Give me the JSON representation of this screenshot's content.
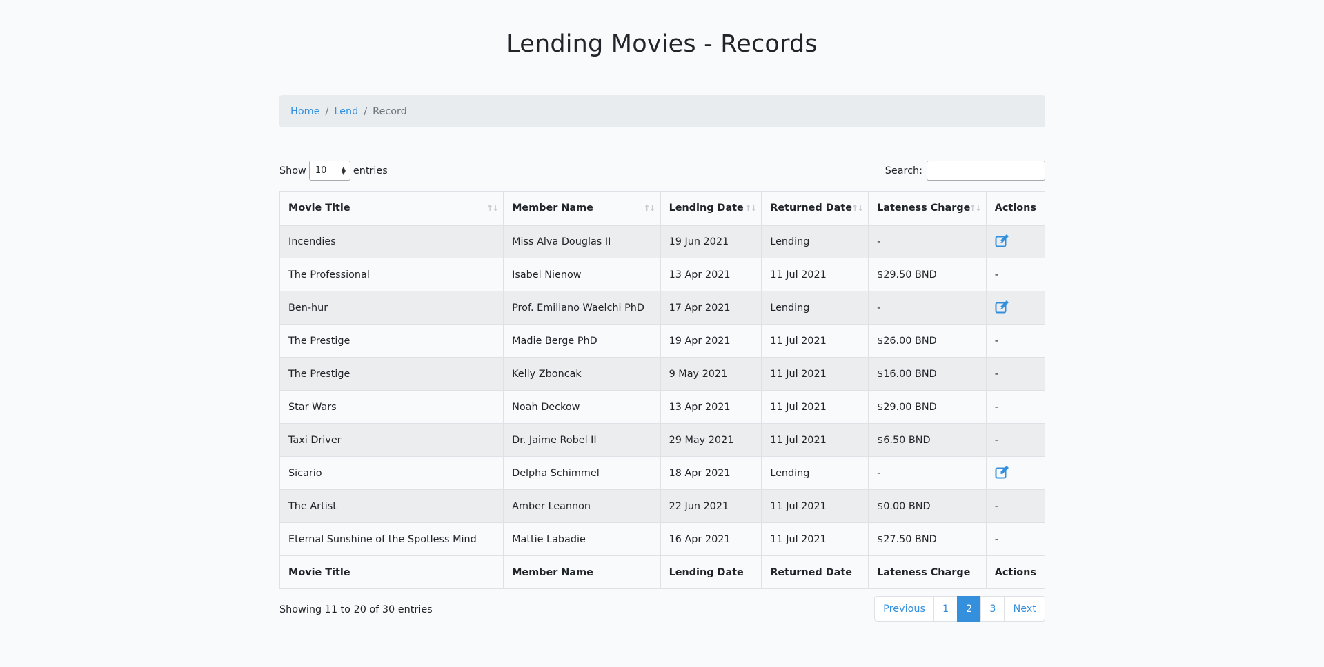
{
  "page": {
    "title": "Lending Movies - Records"
  },
  "breadcrumb": {
    "home": "Home",
    "lend": "Lend",
    "record": "Record",
    "separator": "/"
  },
  "controls": {
    "show_label": "Show",
    "entries_value": "10",
    "entries_label": "entries",
    "search_label": "Search:",
    "search_value": ""
  },
  "table": {
    "columns": [
      "Movie Title",
      "Member Name",
      "Lending Date",
      "Returned Date",
      "Lateness Charge",
      "Actions"
    ],
    "rows": [
      {
        "title": "Incendies",
        "member": "Miss Alva Douglas II",
        "lend": "19 Jun 2021",
        "returned": "Lending",
        "charge": "-",
        "action": "edit"
      },
      {
        "title": "The Professional",
        "member": "Isabel Nienow",
        "lend": "13 Apr 2021",
        "returned": "11 Jul 2021",
        "charge": "$29.50 BND",
        "action": "-"
      },
      {
        "title": "Ben-hur",
        "member": "Prof. Emiliano Waelchi PhD",
        "lend": "17 Apr 2021",
        "returned": "Lending",
        "charge": "-",
        "action": "edit"
      },
      {
        "title": "The Prestige",
        "member": "Madie Berge PhD",
        "lend": "19 Apr 2021",
        "returned": "11 Jul 2021",
        "charge": "$26.00 BND",
        "action": "-"
      },
      {
        "title": "The Prestige",
        "member": "Kelly Zboncak",
        "lend": "9 May 2021",
        "returned": "11 Jul 2021",
        "charge": "$16.00 BND",
        "action": "-"
      },
      {
        "title": "Star Wars",
        "member": "Noah Deckow",
        "lend": "13 Apr 2021",
        "returned": "11 Jul 2021",
        "charge": "$29.00 BND",
        "action": "-"
      },
      {
        "title": "Taxi Driver",
        "member": "Dr. Jaime Robel II",
        "lend": "29 May 2021",
        "returned": "11 Jul 2021",
        "charge": "$6.50 BND",
        "action": "-"
      },
      {
        "title": "Sicario",
        "member": "Delpha Schimmel",
        "lend": "18 Apr 2021",
        "returned": "Lending",
        "charge": "-",
        "action": "edit"
      },
      {
        "title": "The Artist",
        "member": "Amber Leannon",
        "lend": "22 Jun 2021",
        "returned": "11 Jul 2021",
        "charge": "$0.00 BND",
        "action": "-"
      },
      {
        "title": "Eternal Sunshine of the Spotless Mind",
        "member": "Mattie Labadie",
        "lend": "16 Apr 2021",
        "returned": "11 Jul 2021",
        "charge": "$27.50 BND",
        "action": "-"
      }
    ]
  },
  "footer": {
    "info": "Showing 11 to 20 of 30 entries",
    "pagination": {
      "previous": "Previous",
      "pages": [
        "1",
        "2",
        "3"
      ],
      "current": "2",
      "next": "Next"
    }
  },
  "colors": {
    "accent": "#3490dc",
    "background": "#f8fafc",
    "stripe": "#ebedef"
  },
  "icons": {
    "edit": "edit-icon",
    "sort": "sort-icon"
  }
}
